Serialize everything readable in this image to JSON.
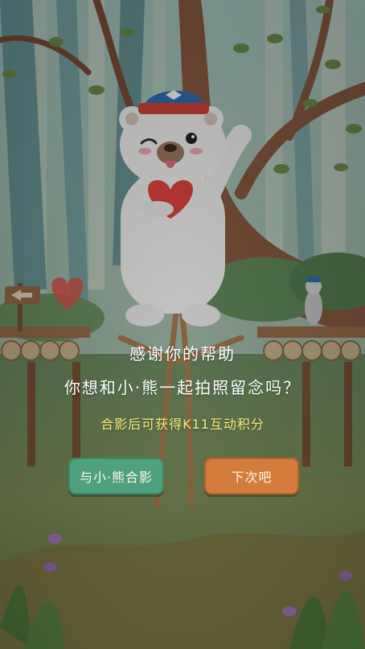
{
  "dialog": {
    "line1": "感谢你的帮助",
    "line2": "你想和小·熊一起拍照留念吗？",
    "line3": "合影后可获得K11互动积分"
  },
  "buttons": {
    "photo_label": "与小·熊合影",
    "next_label": "下次吧"
  },
  "colors": {
    "photo_button": "#4fa07c",
    "next_button": "#d47c3c",
    "reward_text": "#f3ee7a",
    "cap": "#2f6fb5"
  }
}
